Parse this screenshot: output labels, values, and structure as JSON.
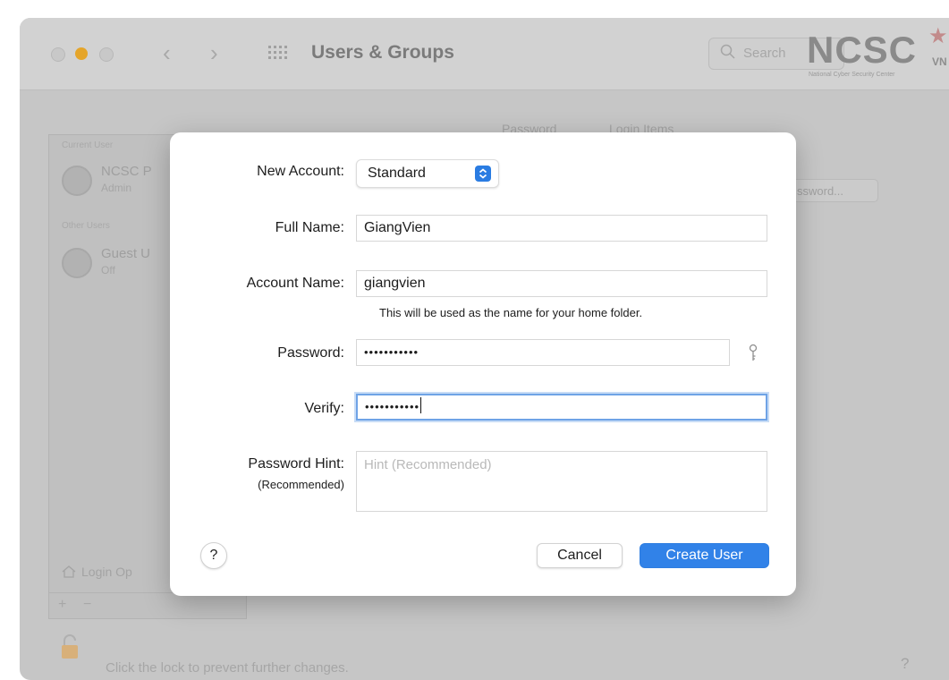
{
  "window": {
    "title": "Users & Groups",
    "search_placeholder": "Search",
    "logo_text": "NCSC",
    "logo_suffix": "VN",
    "logo_subtitle": "National Cyber Security Center"
  },
  "background": {
    "tabs": [
      "Password",
      "Login Items"
    ],
    "sidebar_sections": [
      "Current User",
      "Other Users"
    ],
    "users": [
      {
        "name": "NCSC P",
        "role": "Admin"
      },
      {
        "name": "Guest U",
        "role": "Off"
      }
    ],
    "login_options": "Login Op",
    "change_password_button": "ssword...",
    "lock_text": "Click the lock to prevent further changes.",
    "help": "?"
  },
  "dialog": {
    "new_account": {
      "label": "New Account:",
      "value": "Standard"
    },
    "full_name": {
      "label": "Full Name:",
      "value": "GiangVien"
    },
    "account_name": {
      "label": "Account Name:",
      "value": "giangvien",
      "helper": "This will be used as the name for your home folder."
    },
    "password": {
      "label": "Password:",
      "value": "•••••••••••"
    },
    "verify": {
      "label": "Verify:",
      "value": "•••••••••••"
    },
    "hint": {
      "label": "Password Hint:",
      "sublabel": "(Recommended)",
      "placeholder": "Hint (Recommended)"
    },
    "help_label": "?",
    "cancel_label": "Cancel",
    "create_label": "Create User"
  },
  "colors": {
    "accent": "#3182e8",
    "minimize": "#e5a52a",
    "focus_ring": "#6fa3e6"
  }
}
